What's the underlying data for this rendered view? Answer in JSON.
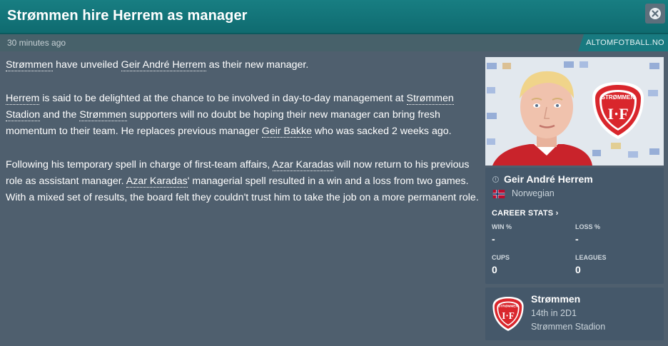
{
  "header": {
    "title": "Strømmen hire Herrem as manager",
    "close_icon": "close-icon"
  },
  "subbar": {
    "time": "30 minutes ago",
    "source": "ALTOMFOTBALL.NO"
  },
  "article": {
    "p1": {
      "club": "Strømmen",
      "t1": " have unveiled ",
      "manager": "Geir André Herrem",
      "t2": " as their new manager."
    },
    "p2": {
      "manager_short": "Herrem",
      "t1": " is said to be delighted at the chance to be involved in day-to-day management at ",
      "stadium": "Strømmen Stadion",
      "t2": " and the ",
      "club": "Strømmen",
      "t3": " supporters will no doubt be hoping their new manager can bring fresh momentum to their team. He replaces previous manager ",
      "prev_manager": "Geir Bakke",
      "t4": " who was sacked 2 weeks ago."
    },
    "p3": {
      "t1": "Following his temporary spell in charge of first-team affairs, ",
      "caretaker": "Azar Karadas",
      "t2": " will now return to his previous role as assistant manager. ",
      "caretaker2": "Azar Karadas",
      "t3": "' managerial spell resulted in a win and a loss from two games. With a mixed set of results, the board felt they couldn't trust him to take the job on a more permanent role."
    }
  },
  "person": {
    "name": "Geir André Herrem",
    "nationality": "Norwegian",
    "career_stats_label": "CAREER STATS ›",
    "stats": {
      "win_label": "WIN %",
      "win_value": "-",
      "loss_label": "LOSS %",
      "loss_value": "-",
      "cups_label": "CUPS",
      "cups_value": "0",
      "leagues_label": "LEAGUES",
      "leagues_value": "0"
    }
  },
  "club": {
    "name": "Strømmen",
    "position": "14th in 2D1",
    "stadium": "Strømmen Stadion",
    "badge_text_top": "STRØMMEN",
    "badge_text_bottom": "I·F",
    "badge_color": "#d9262c"
  },
  "colors": {
    "header": "#187e82",
    "background": "#4f5f6e",
    "card": "#45586a"
  }
}
